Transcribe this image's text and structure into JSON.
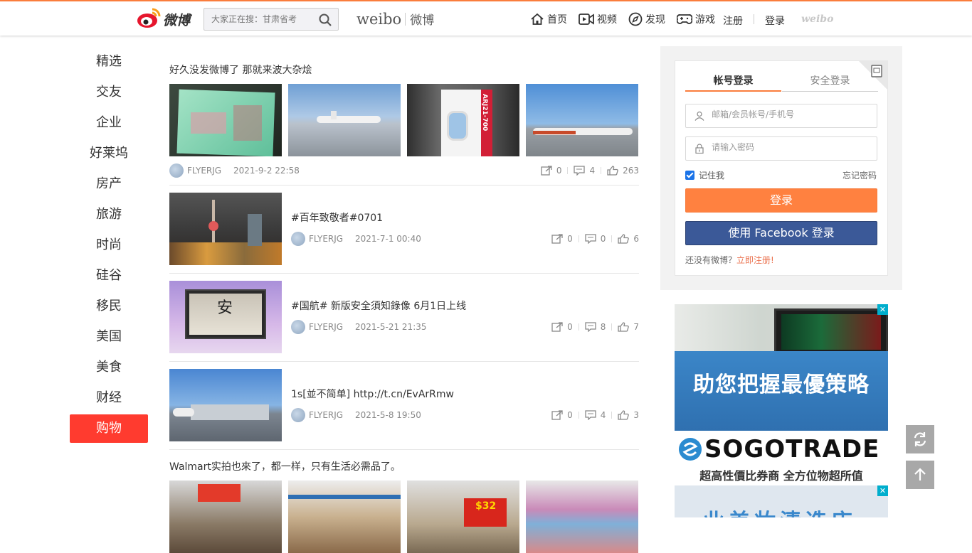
{
  "header": {
    "logo_text": "微博",
    "search_placeholder": "大家正在搜：甘肃省考",
    "brand_en": "weibo",
    "brand_cn": "微博",
    "nav": [
      {
        "label": "首页",
        "icon": "home-icon"
      },
      {
        "label": "视频",
        "icon": "video-icon"
      },
      {
        "label": "发现",
        "icon": "compass-icon"
      },
      {
        "label": "游戏",
        "icon": "gamepad-icon"
      }
    ],
    "register": "注册",
    "login": "登录",
    "weibo_logo": "weibo"
  },
  "sidebar": {
    "items": [
      "精选",
      "交友",
      "企业",
      "好莱坞",
      "房产",
      "旅游",
      "时尚",
      "硅谷",
      "移民",
      "美国",
      "美食",
      "财经",
      "购物"
    ],
    "active": "购物"
  },
  "feed": {
    "posts": [
      {
        "title": "好久没发微博了 那就来波大杂烩",
        "author": "FLYERJG",
        "date": "2021-9-2 22:58",
        "reposts": "0",
        "comments": "4",
        "likes": "263"
      },
      {
        "title": "#百年致敬者#0701",
        "author": "FLYERJG",
        "date": "2021-7-1 00:40",
        "reposts": "0",
        "comments": "0",
        "likes": "6"
      },
      {
        "title": "#国航# 新版安全須知錄像 6月1日上线",
        "author": "FLYERJG",
        "date": "2021-5-21 21:35",
        "reposts": "0",
        "comments": "8",
        "likes": "7"
      },
      {
        "title": "1s[並不简单] http://t.cn/EvArRmw",
        "author": "FLYERJG",
        "date": "2021-5-8 19:50",
        "reposts": "0",
        "comments": "4",
        "likes": "3"
      },
      {
        "title": "Walmart实拍也來了，都一样，只有生活必需品了。"
      }
    ],
    "image_texts": {
      "arj": "ARJ21-700",
      "an": "安",
      "walmart_price": "$32"
    }
  },
  "login": {
    "tab_account": "帐号登录",
    "tab_secure": "安全登录",
    "user_placeholder": "邮箱/会员帐号/手机号",
    "pass_placeholder": "请输入密码",
    "remember": "记住我",
    "forgot": "忘记密码",
    "login_btn": "登录",
    "facebook_btn": "使用 Facebook 登录",
    "no_account": "还没有微博？",
    "register_link": "立即注册!"
  },
  "ads": {
    "ad1_headline": "助您把握最優策略",
    "ad1_brand": "SOGOTRADE",
    "ad1_tagline": "超高性價比券商 全方位物超所值",
    "ad2_text": "业美妆清选店",
    "close": "✕"
  },
  "colors": {
    "accent": "#fa7d3c",
    "active_red": "#ff3b2f",
    "facebook": "#3b5998",
    "login_orange": "#ff8140"
  }
}
